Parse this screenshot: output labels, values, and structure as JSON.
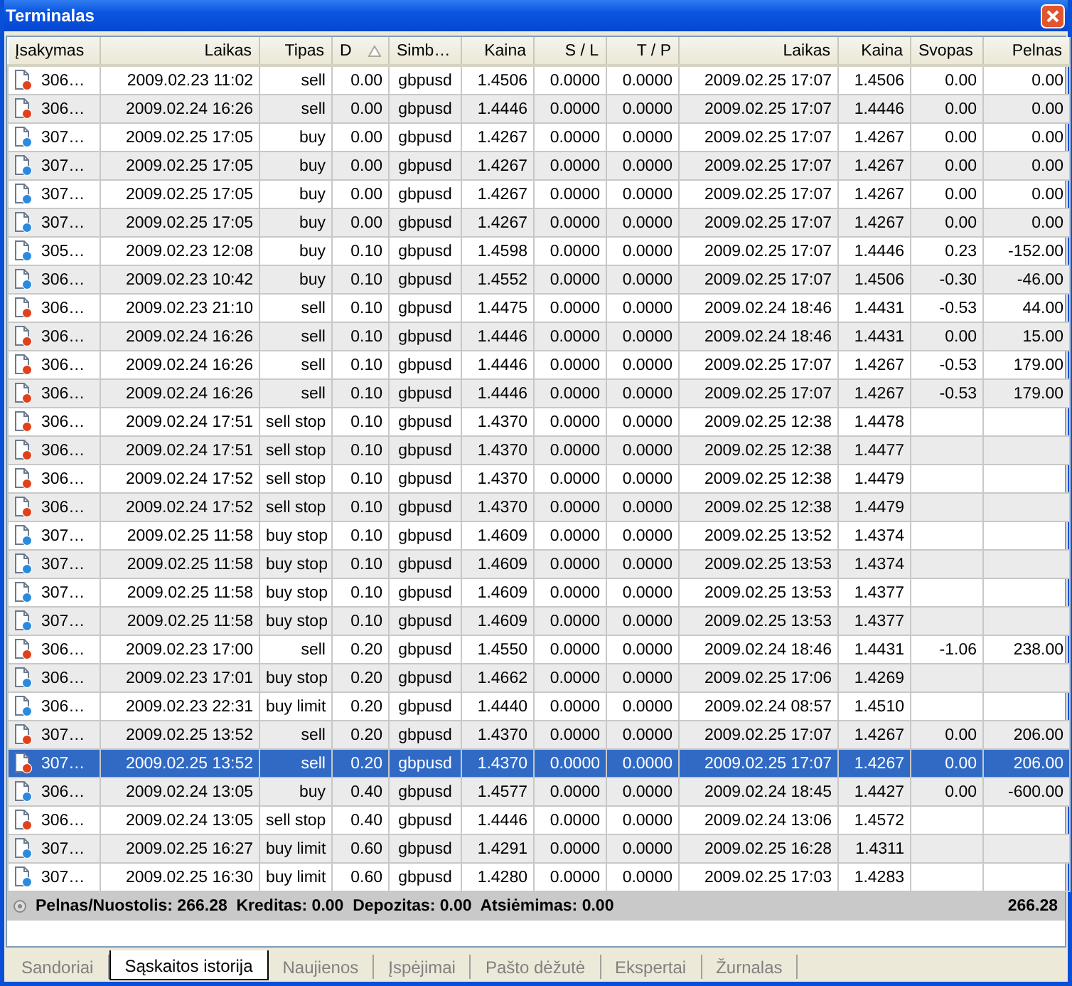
{
  "window": {
    "title": "Terminalas"
  },
  "table": {
    "columns": [
      {
        "label": "Įsakymas",
        "sorted": false
      },
      {
        "label": "Laikas",
        "sorted": false
      },
      {
        "label": "Tipas",
        "sorted": false
      },
      {
        "label": "D",
        "sorted": true
      },
      {
        "label": "Simb…",
        "sorted": false
      },
      {
        "label": "Kaina",
        "sorted": false
      },
      {
        "label": "S / L",
        "sorted": false
      },
      {
        "label": "T / P",
        "sorted": false
      },
      {
        "label": "Laikas",
        "sorted": false
      },
      {
        "label": "Kaina",
        "sorted": false
      },
      {
        "label": "Svopas",
        "sorted": false
      },
      {
        "label": "Pelnas",
        "sorted": false
      }
    ],
    "rows": [
      {
        "kind": "sell",
        "selected": false,
        "cells": [
          "306…",
          "2009.02.23 11:02",
          "sell",
          "0.00",
          "gbpusd",
          "1.4506",
          "0.0000",
          "0.0000",
          "2009.02.25 17:07",
          "1.4506",
          "0.00",
          "0.00"
        ]
      },
      {
        "kind": "sell",
        "selected": false,
        "cells": [
          "306…",
          "2009.02.24 16:26",
          "sell",
          "0.00",
          "gbpusd",
          "1.4446",
          "0.0000",
          "0.0000",
          "2009.02.25 17:07",
          "1.4446",
          "0.00",
          "0.00"
        ]
      },
      {
        "kind": "buy",
        "selected": false,
        "cells": [
          "307…",
          "2009.02.25 17:05",
          "buy",
          "0.00",
          "gbpusd",
          "1.4267",
          "0.0000",
          "0.0000",
          "2009.02.25 17:07",
          "1.4267",
          "0.00",
          "0.00"
        ]
      },
      {
        "kind": "buy",
        "selected": false,
        "cells": [
          "307…",
          "2009.02.25 17:05",
          "buy",
          "0.00",
          "gbpusd",
          "1.4267",
          "0.0000",
          "0.0000",
          "2009.02.25 17:07",
          "1.4267",
          "0.00",
          "0.00"
        ]
      },
      {
        "kind": "buy",
        "selected": false,
        "cells": [
          "307…",
          "2009.02.25 17:05",
          "buy",
          "0.00",
          "gbpusd",
          "1.4267",
          "0.0000",
          "0.0000",
          "2009.02.25 17:07",
          "1.4267",
          "0.00",
          "0.00"
        ]
      },
      {
        "kind": "buy",
        "selected": false,
        "cells": [
          "307…",
          "2009.02.25 17:05",
          "buy",
          "0.00",
          "gbpusd",
          "1.4267",
          "0.0000",
          "0.0000",
          "2009.02.25 17:07",
          "1.4267",
          "0.00",
          "0.00"
        ]
      },
      {
        "kind": "buy",
        "selected": false,
        "cells": [
          "305…",
          "2009.02.23 12:08",
          "buy",
          "0.10",
          "gbpusd",
          "1.4598",
          "0.0000",
          "0.0000",
          "2009.02.25 17:07",
          "1.4446",
          "0.23",
          "-152.00"
        ]
      },
      {
        "kind": "buy",
        "selected": false,
        "cells": [
          "306…",
          "2009.02.23 10:42",
          "buy",
          "0.10",
          "gbpusd",
          "1.4552",
          "0.0000",
          "0.0000",
          "2009.02.25 17:07",
          "1.4506",
          "-0.30",
          "-46.00"
        ]
      },
      {
        "kind": "sell",
        "selected": false,
        "cells": [
          "306…",
          "2009.02.23 21:10",
          "sell",
          "0.10",
          "gbpusd",
          "1.4475",
          "0.0000",
          "0.0000",
          "2009.02.24 18:46",
          "1.4431",
          "-0.53",
          "44.00"
        ]
      },
      {
        "kind": "sell",
        "selected": false,
        "cells": [
          "306…",
          "2009.02.24 16:26",
          "sell",
          "0.10",
          "gbpusd",
          "1.4446",
          "0.0000",
          "0.0000",
          "2009.02.24 18:46",
          "1.4431",
          "0.00",
          "15.00"
        ]
      },
      {
        "kind": "sell",
        "selected": false,
        "cells": [
          "306…",
          "2009.02.24 16:26",
          "sell",
          "0.10",
          "gbpusd",
          "1.4446",
          "0.0000",
          "0.0000",
          "2009.02.25 17:07",
          "1.4267",
          "-0.53",
          "179.00"
        ]
      },
      {
        "kind": "sell",
        "selected": false,
        "cells": [
          "306…",
          "2009.02.24 16:26",
          "sell",
          "0.10",
          "gbpusd",
          "1.4446",
          "0.0000",
          "0.0000",
          "2009.02.25 17:07",
          "1.4267",
          "-0.53",
          "179.00"
        ]
      },
      {
        "kind": "sell",
        "selected": false,
        "cells": [
          "306…",
          "2009.02.24 17:51",
          "sell stop",
          "0.10",
          "gbpusd",
          "1.4370",
          "0.0000",
          "0.0000",
          "2009.02.25 12:38",
          "1.4478"
        ]
      },
      {
        "kind": "sell",
        "selected": false,
        "cells": [
          "306…",
          "2009.02.24 17:51",
          "sell stop",
          "0.10",
          "gbpusd",
          "1.4370",
          "0.0000",
          "0.0000",
          "2009.02.25 12:38",
          "1.4477"
        ]
      },
      {
        "kind": "sell",
        "selected": false,
        "cells": [
          "306…",
          "2009.02.24 17:52",
          "sell stop",
          "0.10",
          "gbpusd",
          "1.4370",
          "0.0000",
          "0.0000",
          "2009.02.25 12:38",
          "1.4479"
        ]
      },
      {
        "kind": "sell",
        "selected": false,
        "cells": [
          "306…",
          "2009.02.24 17:52",
          "sell stop",
          "0.10",
          "gbpusd",
          "1.4370",
          "0.0000",
          "0.0000",
          "2009.02.25 12:38",
          "1.4479"
        ]
      },
      {
        "kind": "buy",
        "selected": false,
        "cells": [
          "307…",
          "2009.02.25 11:58",
          "buy stop",
          "0.10",
          "gbpusd",
          "1.4609",
          "0.0000",
          "0.0000",
          "2009.02.25 13:52",
          "1.4374"
        ]
      },
      {
        "kind": "buy",
        "selected": false,
        "cells": [
          "307…",
          "2009.02.25 11:58",
          "buy stop",
          "0.10",
          "gbpusd",
          "1.4609",
          "0.0000",
          "0.0000",
          "2009.02.25 13:53",
          "1.4374"
        ]
      },
      {
        "kind": "buy",
        "selected": false,
        "cells": [
          "307…",
          "2009.02.25 11:58",
          "buy stop",
          "0.10",
          "gbpusd",
          "1.4609",
          "0.0000",
          "0.0000",
          "2009.02.25 13:53",
          "1.4377"
        ]
      },
      {
        "kind": "buy",
        "selected": false,
        "cells": [
          "307…",
          "2009.02.25 11:58",
          "buy stop",
          "0.10",
          "gbpusd",
          "1.4609",
          "0.0000",
          "0.0000",
          "2009.02.25 13:53",
          "1.4377"
        ]
      },
      {
        "kind": "sell",
        "selected": false,
        "cells": [
          "306…",
          "2009.02.23 17:00",
          "sell",
          "0.20",
          "gbpusd",
          "1.4550",
          "0.0000",
          "0.0000",
          "2009.02.24 18:46",
          "1.4431",
          "-1.06",
          "238.00"
        ]
      },
      {
        "kind": "buy",
        "selected": false,
        "cells": [
          "306…",
          "2009.02.23 17:01",
          "buy stop",
          "0.20",
          "gbpusd",
          "1.4662",
          "0.0000",
          "0.0000",
          "2009.02.25 17:06",
          "1.4269"
        ]
      },
      {
        "kind": "buy",
        "selected": false,
        "cells": [
          "306…",
          "2009.02.23 22:31",
          "buy limit",
          "0.20",
          "gbpusd",
          "1.4440",
          "0.0000",
          "0.0000",
          "2009.02.24 08:57",
          "1.4510"
        ]
      },
      {
        "kind": "sell",
        "selected": false,
        "cells": [
          "307…",
          "2009.02.25 13:52",
          "sell",
          "0.20",
          "gbpusd",
          "1.4370",
          "0.0000",
          "0.0000",
          "2009.02.25 17:07",
          "1.4267",
          "0.00",
          "206.00"
        ]
      },
      {
        "kind": "sell",
        "selected": true,
        "cells": [
          "307…",
          "2009.02.25 13:52",
          "sell",
          "0.20",
          "gbpusd",
          "1.4370",
          "0.0000",
          "0.0000",
          "2009.02.25 17:07",
          "1.4267",
          "0.00",
          "206.00"
        ]
      },
      {
        "kind": "buy",
        "selected": false,
        "cells": [
          "306…",
          "2009.02.24 13:05",
          "buy",
          "0.40",
          "gbpusd",
          "1.4577",
          "0.0000",
          "0.0000",
          "2009.02.24 18:45",
          "1.4427",
          "0.00",
          "-600.00"
        ]
      },
      {
        "kind": "sell",
        "selected": false,
        "cells": [
          "306…",
          "2009.02.24 13:05",
          "sell stop",
          "0.40",
          "gbpusd",
          "1.4446",
          "0.0000",
          "0.0000",
          "2009.02.24 13:06",
          "1.4572"
        ]
      },
      {
        "kind": "buy",
        "selected": false,
        "cells": [
          "307…",
          "2009.02.25 16:27",
          "buy limit",
          "0.60",
          "gbpusd",
          "1.4291",
          "0.0000",
          "0.0000",
          "2009.02.25 16:28",
          "1.4311"
        ]
      },
      {
        "kind": "buy",
        "selected": false,
        "cells": [
          "307…",
          "2009.02.25 16:30",
          "buy limit",
          "0.60",
          "gbpusd",
          "1.4280",
          "0.0000",
          "0.0000",
          "2009.02.25 17:03",
          "1.4283"
        ]
      }
    ]
  },
  "summary": {
    "text": "Pelnas/Nuostolis: 266.28  Kreditas: 0.00  Depozitas: 0.00  Atsiėmimas: 0.00",
    "total": "266.28"
  },
  "tabs": [
    {
      "label": "Sandoriai",
      "selected": false
    },
    {
      "label": "Sąskaitos istorija",
      "selected": true
    },
    {
      "label": "Naujienos",
      "selected": false
    },
    {
      "label": "Įspėjimai",
      "selected": false
    },
    {
      "label": "Pašto dėžutė",
      "selected": false
    },
    {
      "label": "Ekspertai",
      "selected": false
    },
    {
      "label": "Žurnalas",
      "selected": false
    }
  ]
}
